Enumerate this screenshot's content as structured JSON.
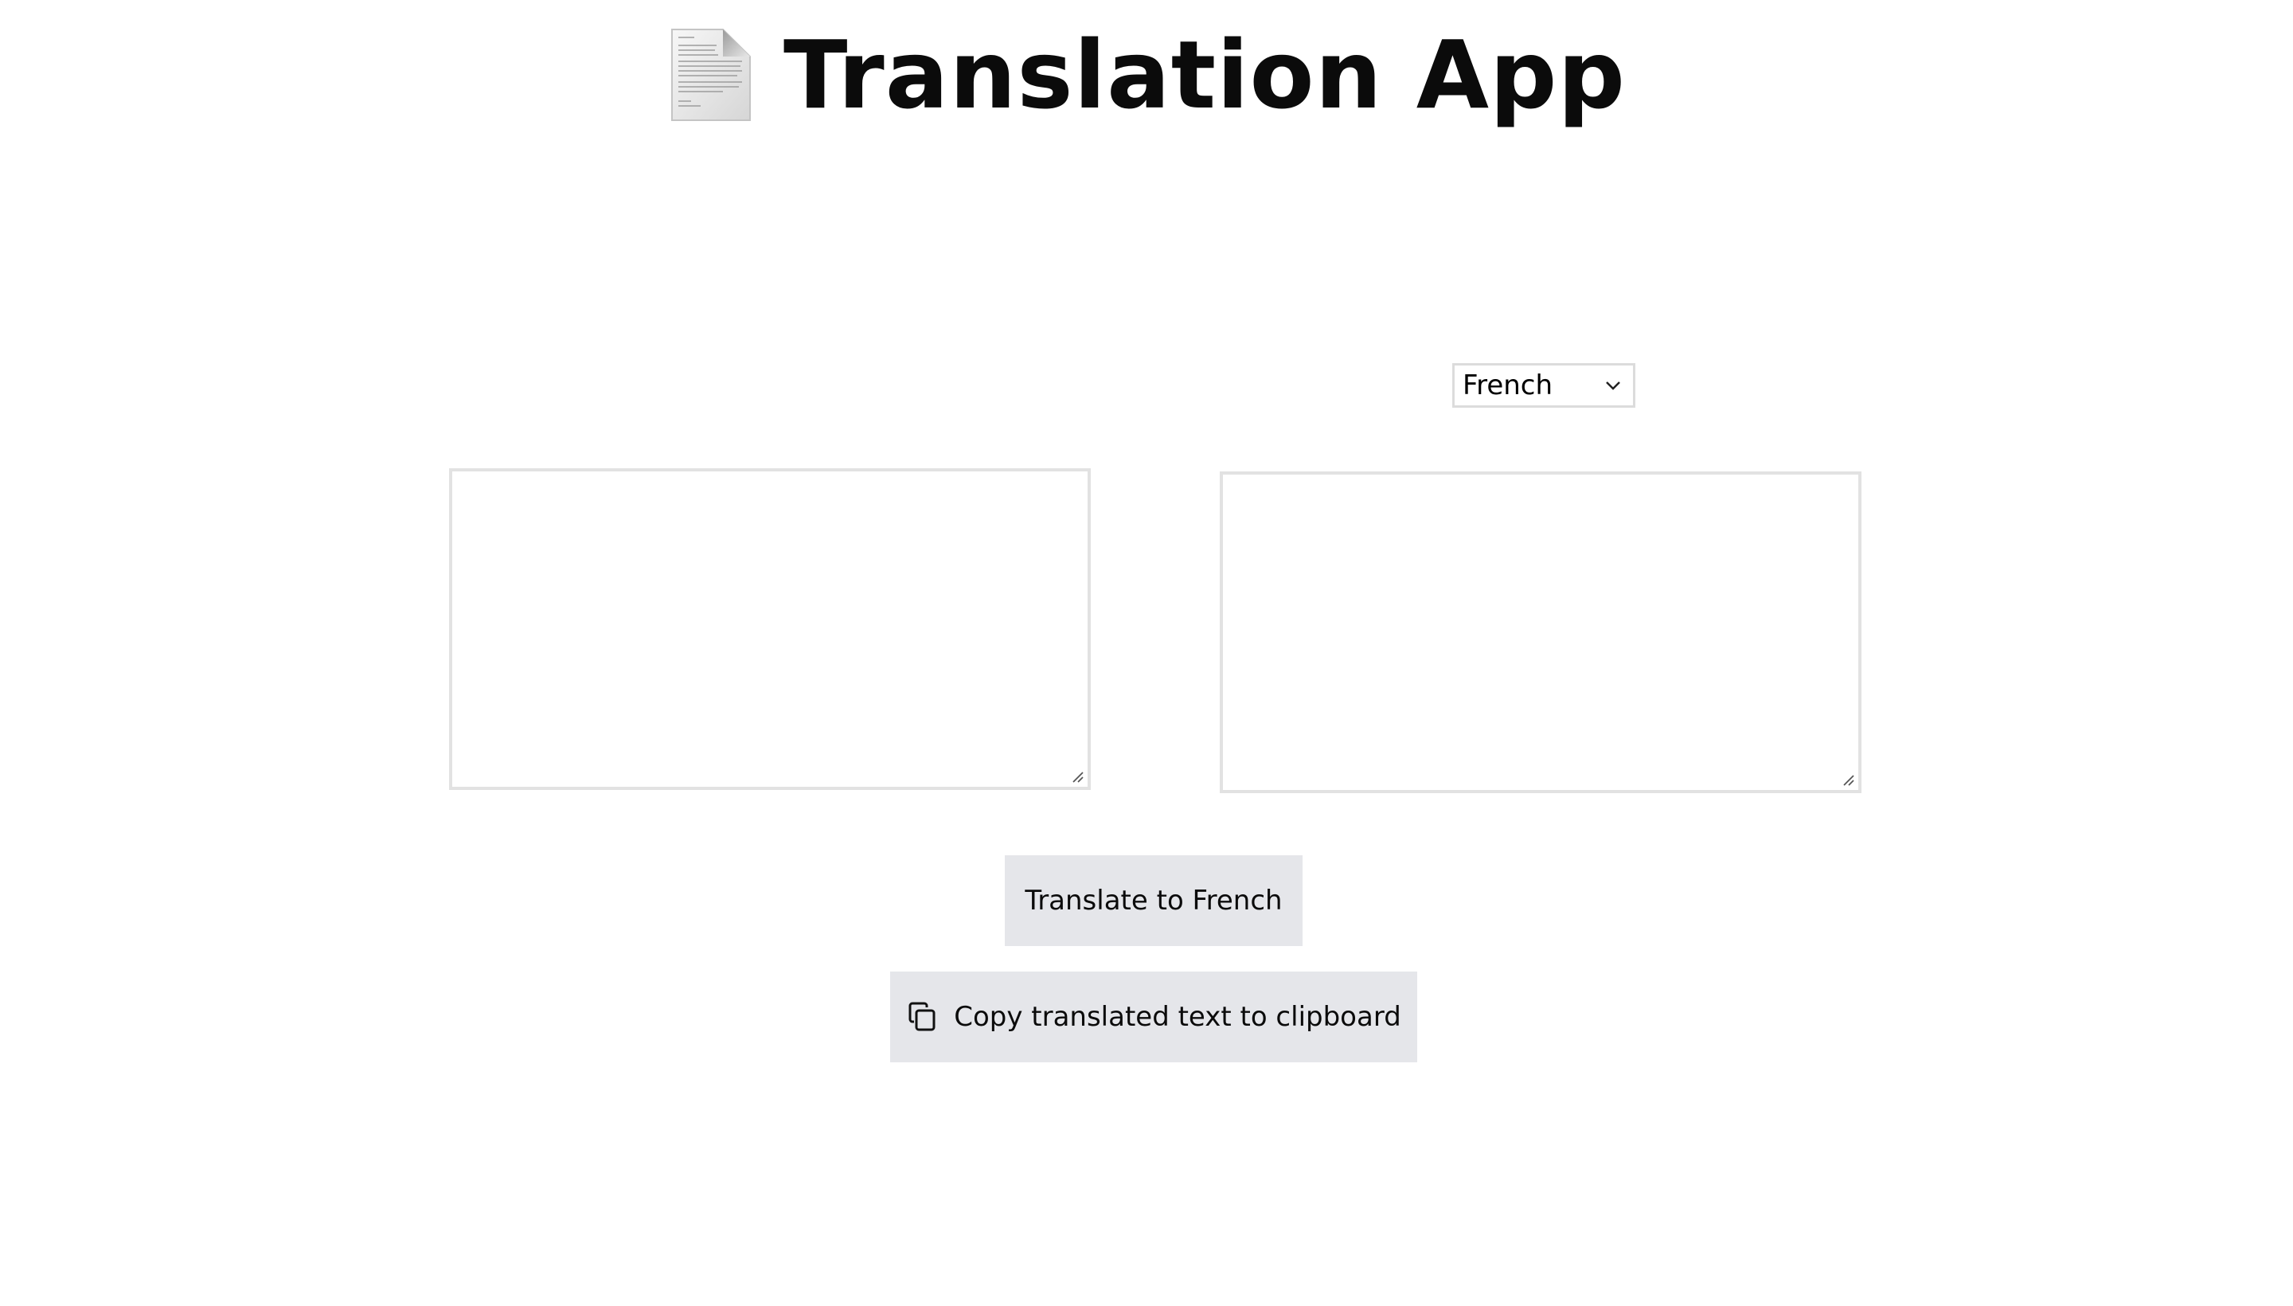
{
  "header": {
    "title": "Translation App",
    "icon": "document-icon"
  },
  "language_select": {
    "selected": "French",
    "icon": "chevron-down-icon"
  },
  "source_text": {
    "value": "",
    "placeholder": ""
  },
  "translated_text": {
    "value": "",
    "placeholder": ""
  },
  "buttons": {
    "translate_label": "Translate to French",
    "copy_label": "Copy translated text to clipboard",
    "copy_icon": "copy-icon"
  },
  "colors": {
    "button_bg": "#e5e6ea",
    "border": "#e2e2e2",
    "text": "#0b0b0b"
  }
}
